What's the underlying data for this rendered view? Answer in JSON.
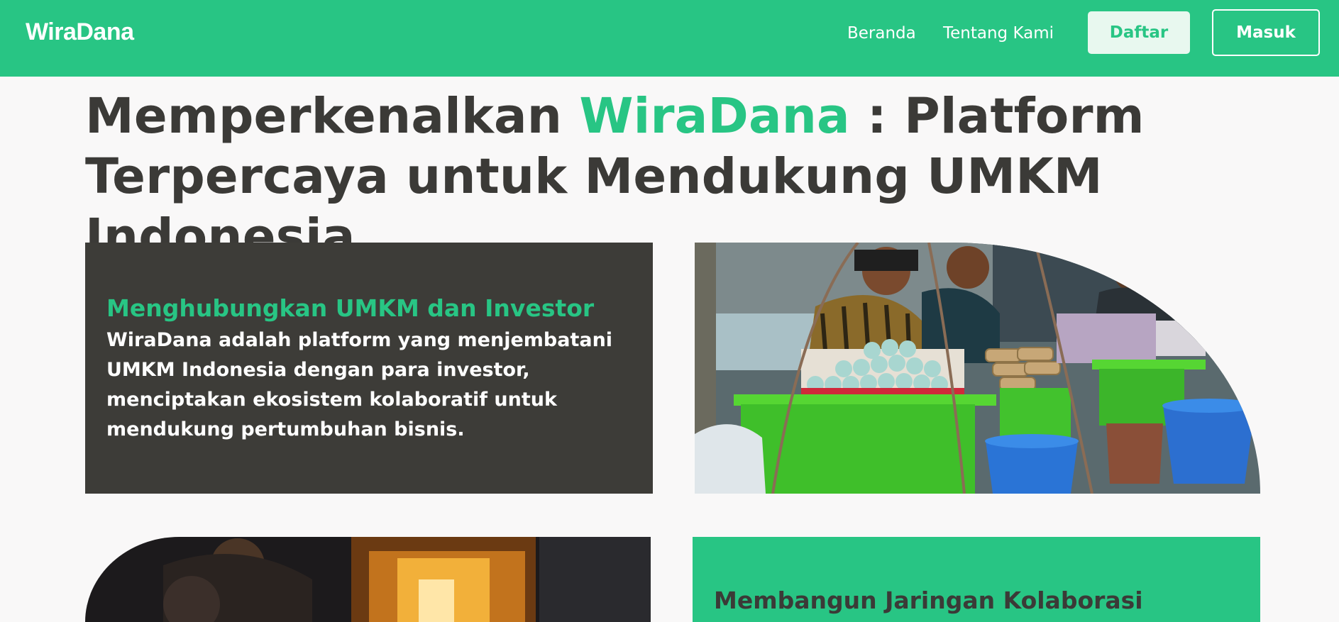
{
  "navbar": {
    "brand": "WiraDana",
    "links": [
      "Beranda",
      "Tentang Kami"
    ],
    "register_label": "Daftar",
    "login_label": "Masuk"
  },
  "hero": {
    "title_before": "Memperkenalkan ",
    "title_accent": "WiraDana",
    "title_after": " : Platform Terpercaya untuk Mendukung UMKM Indonesia."
  },
  "info_card": {
    "heading": "Menghubungkan UMKM dan Investor",
    "body": "WiraDana adalah platform yang menjembatani UMKM Indonesia dengan para investor, menciptakan ekosistem kolaboratif untuk mendukung pertumbuhan bisnis."
  },
  "green_card": {
    "title": "Membangun Jaringan Kolaborasi"
  },
  "colors": {
    "accent": "#28c584",
    "dark_card": "#3d3c38",
    "text_dark": "#3b3a37",
    "page_bg": "#f9f8f8"
  },
  "icons": [
    "market-photo",
    "night-stall-photo"
  ]
}
